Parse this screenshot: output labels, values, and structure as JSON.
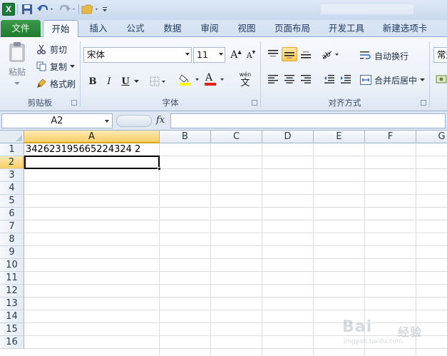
{
  "titlebar": {
    "app_icon_label": "X"
  },
  "tabs": [
    {
      "label": "文件",
      "active": false
    },
    {
      "label": "开始",
      "active": true
    },
    {
      "label": "插入",
      "active": false
    },
    {
      "label": "公式",
      "active": false
    },
    {
      "label": "数据",
      "active": false
    },
    {
      "label": "审阅",
      "active": false
    },
    {
      "label": "视图",
      "active": false
    },
    {
      "label": "页面布局",
      "active": false
    },
    {
      "label": "开发工具",
      "active": false
    },
    {
      "label": "新建选项卡",
      "active": false
    }
  ],
  "clipboard": {
    "paste_label": "粘贴",
    "cut_label": "剪切",
    "copy_label": "复制",
    "format_painter_label": "格式刷",
    "group_label": "剪贴板"
  },
  "font": {
    "name": "宋体",
    "size": "11",
    "bold": "B",
    "italic": "I",
    "underline": "U",
    "grow": "A",
    "shrink": "A",
    "font_color_letter": "A",
    "phonetic": "wén",
    "phonetic_char": "文",
    "group_label": "字体",
    "fill_color": "#ffff00",
    "font_color": "#e2231a"
  },
  "alignment": {
    "wrap_text_label": "自动换行",
    "merge_label": "合并后居中",
    "group_label": "对齐方式"
  },
  "number": {
    "format_value": "常规"
  },
  "formula_bar": {
    "name_box": "A2",
    "fx_label": "fx",
    "formula": ""
  },
  "sheet": {
    "columns": [
      "A",
      "B",
      "C",
      "D",
      "E",
      "F",
      "G"
    ],
    "rows": [
      "1",
      "2",
      "3",
      "4",
      "5",
      "6",
      "7",
      "8",
      "9",
      "10",
      "11",
      "12",
      "13",
      "14",
      "15",
      "16"
    ],
    "selected_column": "A",
    "selected_row": "2",
    "cells": {
      "A1": "342623195665224324 2"
    }
  },
  "watermark": {
    "brand": "Bai",
    "sub": "jingyan.baidu.com",
    "suffix": "经验"
  }
}
